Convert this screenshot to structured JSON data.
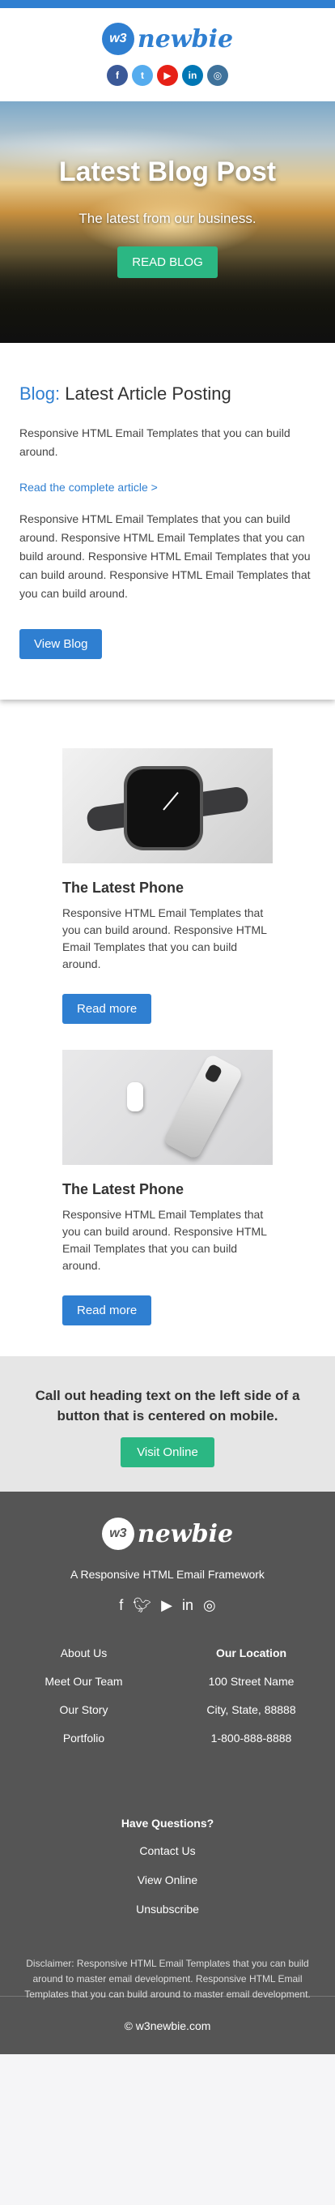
{
  "brand": {
    "badge": "w3",
    "name": "newbie",
    "accent": "#2f7fd1",
    "green": "#2bb783"
  },
  "header_socials": [
    {
      "icon": "facebook-icon",
      "glyph": "f",
      "color": "#3b5998"
    },
    {
      "icon": "twitter-icon",
      "glyph": "t",
      "color": "#55acee"
    },
    {
      "icon": "youtube-icon",
      "glyph": "▶",
      "color": "#e62117"
    },
    {
      "icon": "linkedin-icon",
      "glyph": "in",
      "color": "#0077b5"
    },
    {
      "icon": "instagram-icon",
      "glyph": "◎",
      "color": "#3f729b"
    }
  ],
  "hero": {
    "title": "Latest Blog Post",
    "subtitle": "The latest from our business.",
    "button": "READ BLOG"
  },
  "article": {
    "heading_accent": "Blog:",
    "heading_rest": " Latest Article Posting",
    "intro": "Responsive HTML Email Templates that you can build around.",
    "link": "Read the complete article >",
    "body": "Responsive HTML Email Templates that you can build around. Responsive HTML Email Templates that you can build around. Responsive HTML Email Templates that you can build around. Responsive HTML Email Templates that you can build around.",
    "button": "View Blog"
  },
  "cards": [
    {
      "title": "The Latest Phone",
      "text": "Responsive HTML Email Templates that you can build around. Responsive HTML Email Templates that you can build around.",
      "button": "Read more"
    },
    {
      "title": "The Latest Phone",
      "text": "Responsive HTML Email Templates that you can build around. Responsive HTML Email Templates that you can build around.",
      "button": "Read more"
    }
  ],
  "callout": {
    "heading": "Call out heading text on the left side of a button that is centered on mobile.",
    "button": "Visit Online"
  },
  "footer": {
    "tagline": "A Responsive HTML Email Framework",
    "links": [
      "About Us",
      "Meet Our Team",
      "Our Story",
      "Portfolio"
    ],
    "location_heading": "Our Location",
    "location": [
      "100 Street Name",
      "City, State, 88888",
      "1-800-888-8888"
    ],
    "questions_heading": "Have Questions?",
    "questions_links": [
      "Contact Us",
      "View Online",
      "Unsubscribe"
    ],
    "disclaimer": "Disclaimer: Responsive HTML Email Templates that you can build around to master email development. Responsive HTML Email Templates that you can build around to master email development.",
    "copyright": "© w3newbie.com"
  }
}
